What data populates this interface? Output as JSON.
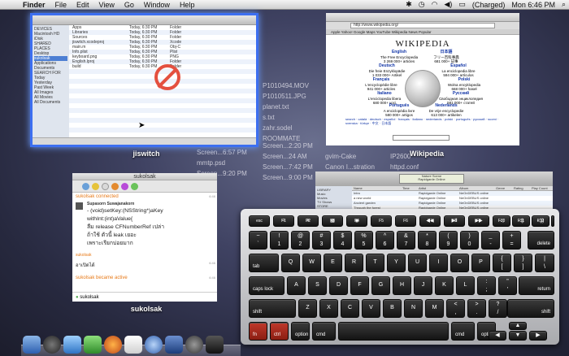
{
  "menubar": {
    "apple": "",
    "items": [
      "Finder",
      "File",
      "Edit",
      "View",
      "Go",
      "Window",
      "Help"
    ],
    "battery": "(Charged)",
    "clock": "Mon 6:46 PM"
  },
  "windows": {
    "finder_label": "jiswitch",
    "wikipedia_label": "Wikipedia",
    "adium_label": "sukolsak"
  },
  "desktop_files": {
    "col1": [
      "P1010494.MOV",
      "P1010511.JPG",
      "planet.txt",
      "Screen...6:57 PM",
      "s.txt",
      "Screen...9:20 PM",
      "zahr.sodel",
      "ROOMMATE",
      "Screen...6:57 PM",
      "Screen...7:42 PM",
      "Screen...9:00 PM",
      "mmtp.psd"
    ],
    "col2": [
      "Screen...2:20 PM",
      "Screen...24 AM",
      "Screen...7:42 PM",
      "Screen...9:00 PM",
      "Canon I...stration",
      "gvim-Cake",
      "IP2600",
      "httpd.conf"
    ]
  },
  "finder": {
    "sidebar": [
      "DEVICES",
      "Macintosh HD",
      "iDisk",
      "SHARED",
      "PLACES",
      "Desktop",
      "sukolsak",
      "Applications",
      "Documents",
      "SEARCH FOR",
      "Today",
      "Yesterday",
      "Past Week",
      "All Images",
      "All Movies",
      "All Documents"
    ],
    "rows": [
      {
        "name": "Apps",
        "date": "Today, 6:30 PM",
        "kind": "Folder"
      },
      {
        "name": "Libraries",
        "date": "Today, 6:30 PM",
        "kind": "Folder"
      },
      {
        "name": "Sources",
        "date": "Today, 6:30 PM",
        "kind": "Folder"
      },
      {
        "name": "jiswitch.xcodeproj",
        "date": "Today, 6:30 PM",
        "kind": "Xcode"
      },
      {
        "name": "main.m",
        "date": "Today, 6:30 PM",
        "kind": "Obj-C"
      },
      {
        "name": "Info.plist",
        "date": "Today, 6:30 PM",
        "kind": "Plist"
      },
      {
        "name": "keyboard.png",
        "date": "Today, 6:30 PM",
        "kind": "PNG"
      },
      {
        "name": "English.lproj",
        "date": "Today, 6:30 PM",
        "kind": "Folder"
      },
      {
        "name": "build",
        "date": "Today, 6:30 PM",
        "kind": "Folder"
      }
    ]
  },
  "wiki": {
    "url": "http://www.wikipedia.org/",
    "bookmarks": "Apple  Yahoo!  Google Maps  YouTube  Wikipedia  News  Popular",
    "logo": "WIKIPEDIA",
    "languages": [
      {
        "name": "English",
        "sub": "The Free Encyclopedia",
        "count": "3 269 000+ articles"
      },
      {
        "name": "日本語",
        "sub": "フリー百科事典",
        "count": "681 000+ 記事"
      },
      {
        "name": "Deutsch",
        "sub": "Die freie Enzyklopädie",
        "count": "1 033 000+ Artikel"
      },
      {
        "name": "Español",
        "sub": "La enciclopedia libre",
        "count": "594 000+ artículos"
      },
      {
        "name": "Français",
        "sub": "L'encyclopédie libre",
        "count": "941 000+ articles"
      },
      {
        "name": "Polski",
        "sub": "Wolna encyklopedia",
        "count": "668 000+ haseł"
      },
      {
        "name": "Italiano",
        "sub": "L'enciclopedia libera",
        "count": "680 000+ voci"
      },
      {
        "name": "Русский",
        "sub": "Свободная энциклопедия",
        "count": "581 000+ статей"
      },
      {
        "name": "Português",
        "sub": "A enciclopédia livre",
        "count": "580 000+ artigos"
      },
      {
        "name": "Nederlands",
        "sub": "De vrije encyclopedie",
        "count": "613 000+ artikelen"
      }
    ],
    "footer": "search · català · deutsch · español · français · italiano · nederlands · polski · português · русский · suomi · svenska · türkçe · 中文 · 日本語"
  },
  "adium": {
    "title": "sukolsak",
    "connected": "sukolsak connected",
    "sender": "Supasorn Suwajanakorn",
    "lines": [
      "- (void)setKey:(NSString*)aKey",
      "withInt:(int)aValue{",
      "ลืม release CFNumberRef เปล่า",
      "ถ้าใช้ ตัวนี้ leak เยอะ",
      "เพราะเรียกบ่อยมาก"
    ],
    "me": "sukolsak",
    "reply": "อาเปิดได้",
    "active": "sukolsak became active",
    "times": [
      "6:46",
      "6:46",
      "6:46"
    ],
    "input": "sukolsak"
  },
  "itunes": {
    "now_playing": "Nature Scene",
    "artist": "Rapidgarde Online",
    "columns": [
      "Name",
      "Time",
      "Artist",
      "Album",
      "Genre",
      "Rating",
      "Play Count"
    ],
    "rows": [
      {
        "name": "Intro",
        "artist": "Rapidgarde Online",
        "album": "NeOnDEBUS online"
      },
      {
        "name": "a new world",
        "artist": "Rapidgarde Online",
        "album": "NeOnDEBUS online"
      },
      {
        "name": "Ancient garden",
        "artist": "Rapidgarde Online",
        "album": "NeOnDEBUS online"
      },
      {
        "name": "Through the forest",
        "artist": "Rapidgarde Online",
        "album": "NeOnDEBUS online"
      },
      {
        "name": "Harmony",
        "artist": "Rapidgarde Online",
        "album": "NeOnDEBUS online"
      },
      {
        "name": "Travel",
        "artist": "Rapidgarde Online",
        "album": "NeOnDEBUS online"
      },
      {
        "name": "Weapon",
        "artist": "Rapidgarde Online",
        "album": "NeOnDEBUS online"
      }
    ],
    "sidebar": [
      "LIBRARY",
      "Music",
      "Movies",
      "TV Shows",
      "STORE",
      "iTunes Store",
      "PLAYLISTS",
      "Party Shuffle",
      "Genius"
    ]
  },
  "keyboard": {
    "fn_row": [
      "esc",
      "F1",
      "F2",
      "F3",
      "F4",
      "F5",
      "F6",
      "F7",
      "F8",
      "F9",
      "F10",
      "F11",
      "F12",
      ""
    ],
    "num_row": [
      [
        "~",
        "`"
      ],
      [
        "!",
        "1"
      ],
      [
        "@",
        "2"
      ],
      [
        "#",
        "3"
      ],
      [
        "$",
        "4"
      ],
      [
        "%",
        "5"
      ],
      [
        "^",
        "6"
      ],
      [
        "&",
        "7"
      ],
      [
        "*",
        "8"
      ],
      [
        "(",
        "9"
      ],
      [
        ")",
        "0"
      ],
      [
        "_",
        "-"
      ],
      [
        "+",
        "="
      ]
    ],
    "delete": "delete",
    "tab": "tab",
    "qrow": [
      "Q",
      "W",
      "E",
      "R",
      "T",
      "Y",
      "U",
      "I",
      "O",
      "P"
    ],
    "qrow_sym": [
      [
        "{",
        "["
      ],
      [
        "}",
        "]"
      ],
      [
        "|",
        "\\"
      ]
    ],
    "caps": "caps lock",
    "arow": [
      "A",
      "S",
      "D",
      "F",
      "G",
      "H",
      "J",
      "K",
      "L"
    ],
    "arow_sym": [
      [
        ":",
        ";"
      ],
      [
        "\"",
        "'"
      ]
    ],
    "return": "return",
    "shift": "shift",
    "zrow": [
      "Z",
      "X",
      "C",
      "V",
      "B",
      "N",
      "M"
    ],
    "zrow_sym": [
      [
        "<",
        ","
      ],
      [
        ">",
        "."
      ],
      [
        "?",
        "/"
      ]
    ],
    "fn": "fn",
    "control": "ctrl",
    "option": "option",
    "command": "cmd",
    "option_r": "option",
    "command_r": "cmd",
    "arrows": [
      "◀",
      "▲",
      "▼",
      "▶"
    ],
    "highlight_color": "#b03325"
  }
}
